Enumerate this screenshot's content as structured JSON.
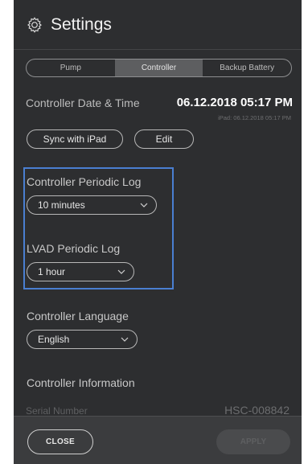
{
  "header": {
    "title": "Settings",
    "icon": "gear-icon"
  },
  "tabs": [
    {
      "label": "Pump",
      "active": false
    },
    {
      "label": "Controller",
      "active": true
    },
    {
      "label": "Backup Battery",
      "active": false
    }
  ],
  "date_time": {
    "label": "Controller Date & Time",
    "value": "06.12.2018 05:17 PM",
    "ipad_value": "iPad: 06.12.2018 05:17 PM"
  },
  "actions": {
    "sync_label": "Sync with iPad",
    "edit_label": "Edit"
  },
  "controller_periodic_log": {
    "label": "Controller Periodic Log",
    "value": "10 minutes"
  },
  "lvad_periodic_log": {
    "label": "LVAD Periodic Log",
    "value": "1 hour"
  },
  "controller_language": {
    "label": "Controller Language",
    "value": "English"
  },
  "controller_information": {
    "label": "Controller Information",
    "serial_label": "Serial Number",
    "serial_value": "HSC-008842"
  },
  "footer": {
    "close_label": "CLOSE",
    "apply_label": "APPLY"
  },
  "colors": {
    "panel_bg": "#2d2e30",
    "highlight": "#4a7fd1",
    "active_tab": "#5d5e60"
  }
}
